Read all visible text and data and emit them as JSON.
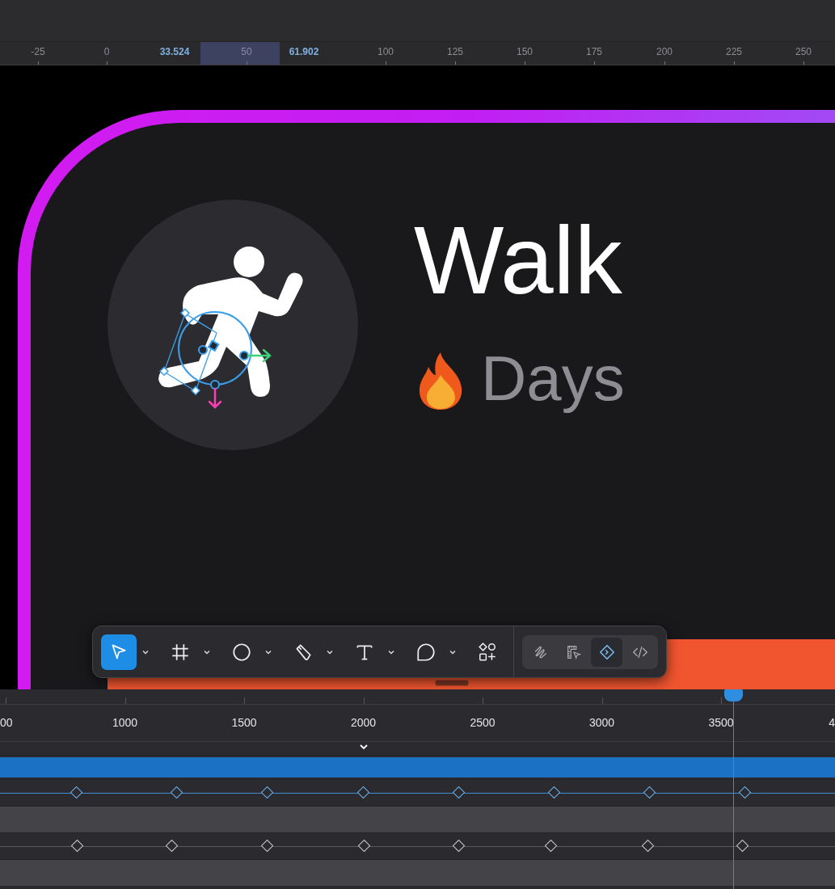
{
  "ruler": {
    "labels": [
      {
        "text": "-25",
        "kind": "tick"
      },
      {
        "text": "0",
        "kind": "dim"
      },
      {
        "text": "33.524",
        "kind": "bound"
      },
      {
        "text": "50",
        "kind": "dim"
      },
      {
        "text": "61.902",
        "kind": "bound"
      },
      {
        "text": "100",
        "kind": "tick"
      },
      {
        "text": "125",
        "kind": "tick"
      },
      {
        "text": "150",
        "kind": "tick"
      },
      {
        "text": "175",
        "kind": "tick"
      },
      {
        "text": "200",
        "kind": "tick"
      },
      {
        "text": "225",
        "kind": "tick"
      },
      {
        "text": "250",
        "kind": "tick"
      }
    ]
  },
  "card": {
    "title": "Walk",
    "subtitle": "Days"
  },
  "toolbar": {
    "tools": [
      {
        "kind": "select",
        "selected": true,
        "has_menu": true
      },
      {
        "kind": "frame",
        "selected": false,
        "has_menu": true
      },
      {
        "kind": "ellipse",
        "selected": false,
        "has_menu": true
      },
      {
        "kind": "pen",
        "selected": false,
        "has_menu": true
      },
      {
        "kind": "text",
        "selected": false,
        "has_menu": true
      },
      {
        "kind": "comment",
        "selected": false,
        "has_menu": true
      },
      {
        "kind": "shapes",
        "selected": false,
        "has_menu": false
      }
    ],
    "modes": [
      {
        "kind": "draw",
        "selected": false
      },
      {
        "kind": "design",
        "selected": false
      },
      {
        "kind": "prototype",
        "selected": true
      },
      {
        "kind": "code",
        "selected": false
      }
    ]
  },
  "timeline": {
    "labels": [
      "00",
      "1000",
      "1500",
      "2000",
      "2500",
      "3000",
      "3500",
      "4"
    ],
    "playhead": {
      "level": 0.878
    },
    "tracks": [
      {
        "kind": "bar"
      },
      {
        "kind": "keyframes",
        "selected": true,
        "keyframes": [
          {
            "level": 0.092
          },
          {
            "level": 0.212
          },
          {
            "level": 0.32
          },
          {
            "level": 0.436
          },
          {
            "level": 0.55
          },
          {
            "level": 0.664
          },
          {
            "level": 0.778
          },
          {
            "level": 0.893
          }
        ]
      },
      {
        "kind": "empty"
      },
      {
        "kind": "keyframes",
        "selected": false,
        "keyframes": [
          {
            "level": 0.093
          },
          {
            "level": 0.206
          },
          {
            "level": 0.32
          },
          {
            "level": 0.437
          },
          {
            "level": 0.55
          },
          {
            "level": 0.66
          },
          {
            "level": 0.776
          },
          {
            "level": 0.89
          }
        ]
      },
      {
        "kind": "empty"
      }
    ]
  }
}
